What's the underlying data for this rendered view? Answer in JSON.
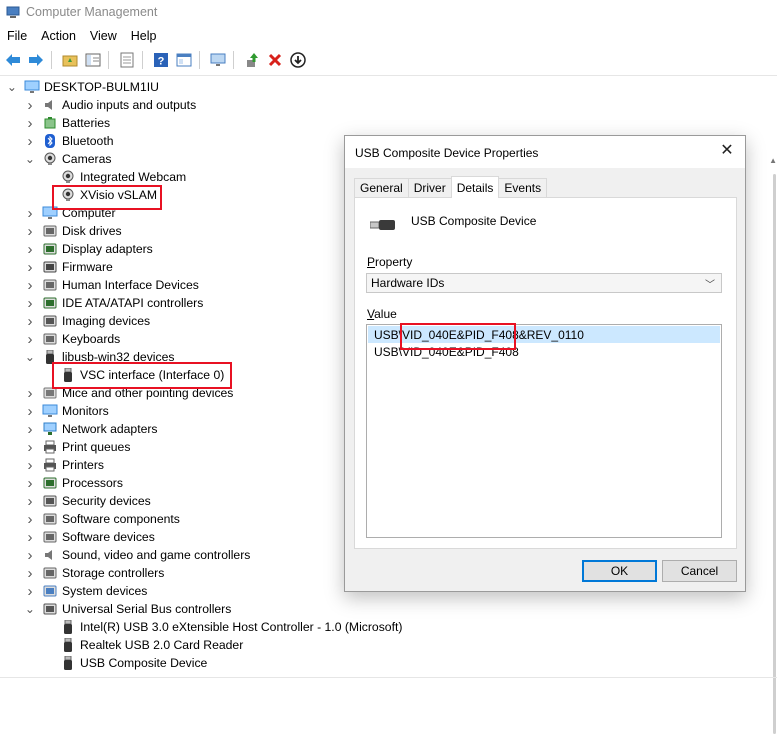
{
  "window": {
    "title": "Computer Management"
  },
  "menu": [
    "File",
    "Action",
    "View",
    "Help"
  ],
  "toolbar": [
    "back-icon",
    "forward-icon",
    "up-folder-icon",
    "show-hide-tree-icon",
    "export-icon",
    "help-icon",
    "properties-icon",
    "monitor-icon",
    "update-driver-icon",
    "uninstall-icon",
    "disable-icon"
  ],
  "tree": {
    "root": "DESKTOP-BULM1IU",
    "items": [
      {
        "label": "Audio inputs and outputs",
        "icon": "speaker-icon",
        "level": 1,
        "expanded": false
      },
      {
        "label": "Batteries",
        "icon": "battery-icon",
        "level": 1,
        "expanded": false
      },
      {
        "label": "Bluetooth",
        "icon": "bluetooth-icon",
        "level": 1,
        "expanded": false
      },
      {
        "label": "Cameras",
        "icon": "camera-icon",
        "level": 1,
        "expanded": true
      },
      {
        "label": "Integrated Webcam",
        "icon": "camera-icon",
        "level": 2
      },
      {
        "label": "XVisio vSLAM",
        "icon": "camera-icon",
        "level": 2
      },
      {
        "label": "Computer",
        "icon": "computer-icon",
        "level": 1,
        "expanded": false
      },
      {
        "label": "Disk drives",
        "icon": "disk-icon",
        "level": 1,
        "expanded": false
      },
      {
        "label": "Display adapters",
        "icon": "display-adapter-icon",
        "level": 1,
        "expanded": false
      },
      {
        "label": "Firmware",
        "icon": "firmware-icon",
        "level": 1,
        "expanded": false
      },
      {
        "label": "Human Interface Devices",
        "icon": "hid-icon",
        "level": 1,
        "expanded": false
      },
      {
        "label": "IDE ATA/ATAPI controllers",
        "icon": "ide-icon",
        "level": 1,
        "expanded": false
      },
      {
        "label": "Imaging devices",
        "icon": "imaging-icon",
        "level": 1,
        "expanded": false
      },
      {
        "label": "Keyboards",
        "icon": "keyboard-icon",
        "level": 1,
        "expanded": false
      },
      {
        "label": "libusb-win32 devices",
        "icon": "usb-plug-icon",
        "level": 1,
        "expanded": true
      },
      {
        "label": "VSC interface (Interface 0)",
        "icon": "usb-plug-icon",
        "level": 2
      },
      {
        "label": "Mice and other pointing devices",
        "icon": "mouse-icon",
        "level": 1,
        "expanded": false
      },
      {
        "label": "Monitors",
        "icon": "monitor-icon",
        "level": 1,
        "expanded": false
      },
      {
        "label": "Network adapters",
        "icon": "network-icon",
        "level": 1,
        "expanded": false
      },
      {
        "label": "Print queues",
        "icon": "printer-icon",
        "level": 1,
        "expanded": false
      },
      {
        "label": "Printers",
        "icon": "printer-icon",
        "level": 1,
        "expanded": false
      },
      {
        "label": "Processors",
        "icon": "processor-icon",
        "level": 1,
        "expanded": false
      },
      {
        "label": "Security devices",
        "icon": "security-icon",
        "level": 1,
        "expanded": false
      },
      {
        "label": "Software components",
        "icon": "software-component-icon",
        "level": 1,
        "expanded": false
      },
      {
        "label": "Software devices",
        "icon": "software-device-icon",
        "level": 1,
        "expanded": false
      },
      {
        "label": "Sound, video and game controllers",
        "icon": "speaker-icon",
        "level": 1,
        "expanded": false
      },
      {
        "label": "Storage controllers",
        "icon": "storage-icon",
        "level": 1,
        "expanded": false
      },
      {
        "label": "System devices",
        "icon": "system-icon",
        "level": 1,
        "expanded": false
      },
      {
        "label": "Universal Serial Bus controllers",
        "icon": "usb-controller-icon",
        "level": 1,
        "expanded": true
      },
      {
        "label": "Intel(R) USB 3.0 eXtensible Host Controller - 1.0 (Microsoft)",
        "icon": "usb-plug-icon",
        "level": 2
      },
      {
        "label": "Realtek USB 2.0 Card Reader",
        "icon": "usb-plug-icon",
        "level": 2
      },
      {
        "label": "USB Composite Device",
        "icon": "usb-plug-icon",
        "level": 2
      }
    ]
  },
  "dialog": {
    "title": "USB Composite Device Properties",
    "tabs": [
      "General",
      "Driver",
      "Details",
      "Events"
    ],
    "active_tab": "Details",
    "device_name": "USB Composite Device",
    "property_label": "Property",
    "property_value": "Hardware IDs",
    "value_label": "Value",
    "values": [
      "USB\\VID_040E&PID_F408&REV_0110",
      "USB\\VID_040E&PID_F408"
    ],
    "ok_label": "OK",
    "cancel_label": "Cancel"
  },
  "colors": {
    "highlight_box": "#e81123",
    "selection": "#cce8ff",
    "accent": "#0078d7"
  }
}
